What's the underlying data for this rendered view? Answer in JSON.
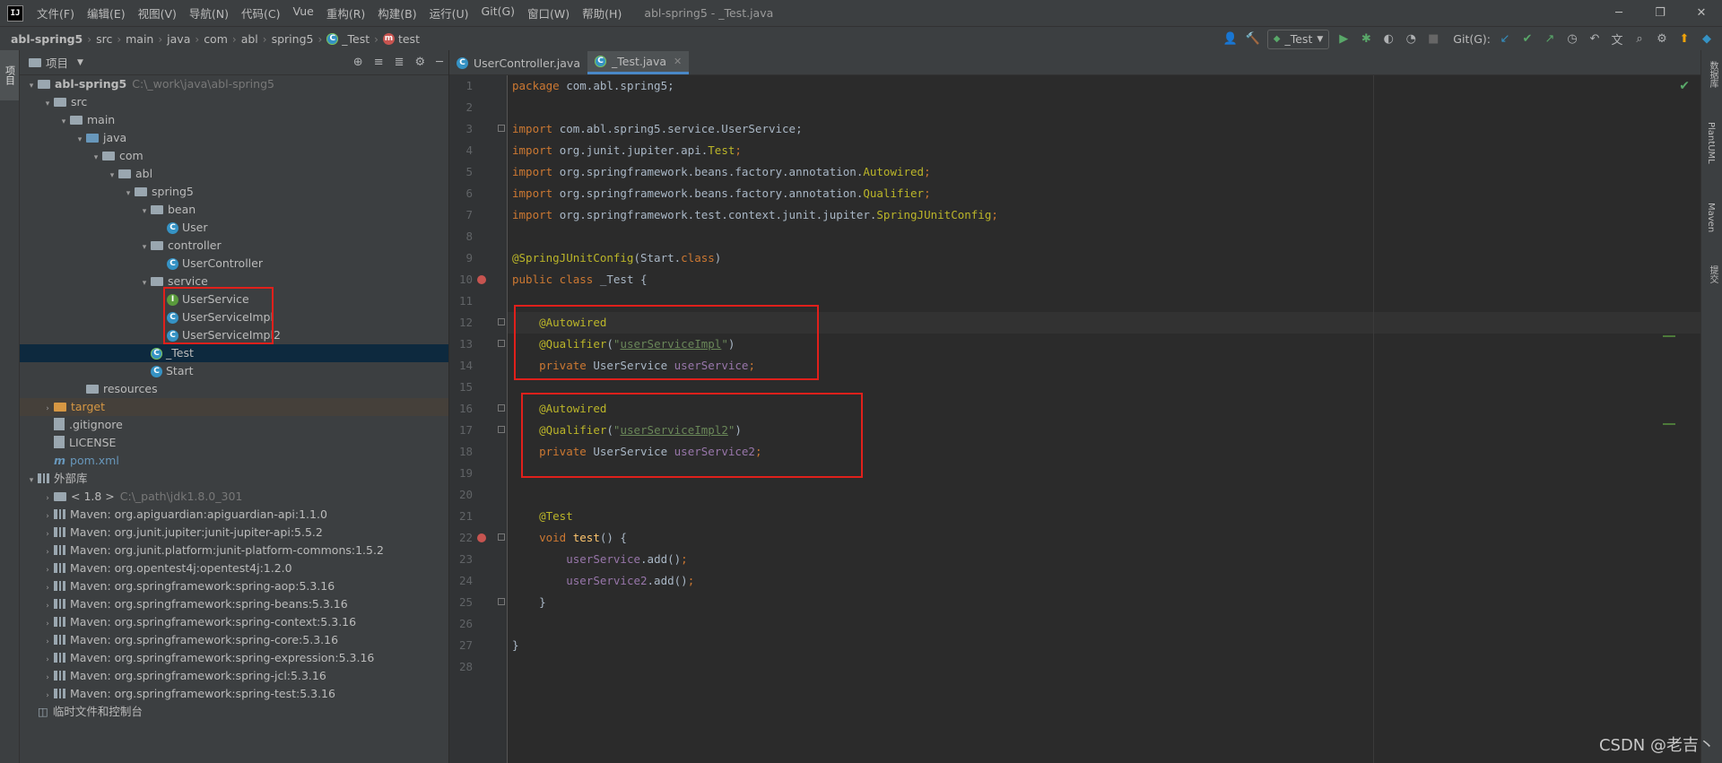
{
  "menubar": {
    "logo": "IJ",
    "items": [
      "文件(F)",
      "编辑(E)",
      "视图(V)",
      "导航(N)",
      "代码(C)",
      "Vue",
      "重构(R)",
      "构建(B)",
      "运行(U)",
      "Git(G)",
      "窗口(W)",
      "帮助(H)"
    ],
    "title": "abl-spring5 - _Test.java",
    "controls": [
      "─",
      "❐",
      "✕"
    ]
  },
  "breadcrumb": {
    "items": [
      "abl-spring5",
      "src",
      "main",
      "java",
      "com",
      "abl",
      "spring5",
      "_Test",
      "test"
    ]
  },
  "toolbar": {
    "run_config": "_Test",
    "git_label": "Git(G):"
  },
  "project_panel": {
    "title": "项目",
    "tree": [
      {
        "label": "abl-spring5",
        "path": "C:\\_work\\java\\abl-spring5",
        "depth": 0,
        "arrow": "▾",
        "icon": "folder",
        "bold": true
      },
      {
        "label": "src",
        "depth": 1,
        "arrow": "▾",
        "icon": "folder"
      },
      {
        "label": "main",
        "depth": 2,
        "arrow": "▾",
        "icon": "folder"
      },
      {
        "label": "java",
        "depth": 3,
        "arrow": "▾",
        "icon": "folder-blue"
      },
      {
        "label": "com",
        "depth": 4,
        "arrow": "▾",
        "icon": "folder"
      },
      {
        "label": "abl",
        "depth": 5,
        "arrow": "▾",
        "icon": "folder"
      },
      {
        "label": "spring5",
        "depth": 6,
        "arrow": "▾",
        "icon": "folder"
      },
      {
        "label": "bean",
        "depth": 7,
        "arrow": "▾",
        "icon": "folder"
      },
      {
        "label": "User",
        "depth": 8,
        "arrow": "",
        "icon": "class"
      },
      {
        "label": "controller",
        "depth": 7,
        "arrow": "▾",
        "icon": "folder"
      },
      {
        "label": "UserController",
        "depth": 8,
        "arrow": "",
        "icon": "class"
      },
      {
        "label": "service",
        "depth": 7,
        "arrow": "▾",
        "icon": "folder"
      },
      {
        "label": "UserService",
        "depth": 8,
        "arrow": "",
        "icon": "interface"
      },
      {
        "label": "UserServiceImpl",
        "depth": 8,
        "arrow": "",
        "icon": "class"
      },
      {
        "label": "UserServiceImpl2",
        "depth": 8,
        "arrow": "",
        "icon": "class"
      },
      {
        "label": "_Test",
        "depth": 7,
        "arrow": "",
        "icon": "test",
        "selected": true
      },
      {
        "label": "Start",
        "depth": 7,
        "arrow": "",
        "icon": "class"
      },
      {
        "label": "resources",
        "depth": 3,
        "arrow": "",
        "icon": "folder"
      },
      {
        "label": "target",
        "depth": 1,
        "arrow": "›",
        "icon": "folder-orange",
        "excluded": true
      },
      {
        "label": ".gitignore",
        "depth": 1,
        "arrow": "",
        "icon": "file"
      },
      {
        "label": "LICENSE",
        "depth": 1,
        "arrow": "",
        "icon": "file"
      },
      {
        "label": "pom.xml",
        "depth": 1,
        "arrow": "",
        "icon": "maven",
        "blue": true
      },
      {
        "label": "外部库",
        "depth": 0,
        "arrow": "▾",
        "icon": "lib"
      },
      {
        "label": "< 1.8 >",
        "path": "C:\\_path\\jdk1.8.0_301",
        "depth": 1,
        "arrow": "›",
        "icon": "folder"
      },
      {
        "label": "Maven: org.apiguardian:apiguardian-api:1.1.0",
        "depth": 1,
        "arrow": "›",
        "icon": "lib"
      },
      {
        "label": "Maven: org.junit.jupiter:junit-jupiter-api:5.5.2",
        "depth": 1,
        "arrow": "›",
        "icon": "lib"
      },
      {
        "label": "Maven: org.junit.platform:junit-platform-commons:1.5.2",
        "depth": 1,
        "arrow": "›",
        "icon": "lib"
      },
      {
        "label": "Maven: org.opentest4j:opentest4j:1.2.0",
        "depth": 1,
        "arrow": "›",
        "icon": "lib"
      },
      {
        "label": "Maven: org.springframework:spring-aop:5.3.16",
        "depth": 1,
        "arrow": "›",
        "icon": "lib"
      },
      {
        "label": "Maven: org.springframework:spring-beans:5.3.16",
        "depth": 1,
        "arrow": "›",
        "icon": "lib"
      },
      {
        "label": "Maven: org.springframework:spring-context:5.3.16",
        "depth": 1,
        "arrow": "›",
        "icon": "lib"
      },
      {
        "label": "Maven: org.springframework:spring-core:5.3.16",
        "depth": 1,
        "arrow": "›",
        "icon": "lib"
      },
      {
        "label": "Maven: org.springframework:spring-expression:5.3.16",
        "depth": 1,
        "arrow": "›",
        "icon": "lib"
      },
      {
        "label": "Maven: org.springframework:spring-jcl:5.3.16",
        "depth": 1,
        "arrow": "›",
        "icon": "lib"
      },
      {
        "label": "Maven: org.springframework:spring-test:5.3.16",
        "depth": 1,
        "arrow": "›",
        "icon": "lib"
      },
      {
        "label": "临时文件和控制台",
        "depth": 0,
        "arrow": "",
        "icon": "scratch"
      }
    ]
  },
  "tabs": [
    {
      "label": "UserController.java",
      "active": false
    },
    {
      "label": "_Test.java",
      "active": true
    }
  ],
  "editor": {
    "lines": [
      [
        [
          "kw",
          "package "
        ],
        [
          "",
          "com.abl.spring5;"
        ]
      ],
      [],
      [
        [
          "kw",
          "import "
        ],
        [
          "",
          "com.abl.spring5.service.UserService;"
        ]
      ],
      [
        [
          "kw",
          "import "
        ],
        [
          "",
          "org.junit.jupiter.api."
        ],
        [
          "ann",
          "Test"
        ],
        [
          "kw",
          ";"
        ]
      ],
      [
        [
          "kw",
          "import "
        ],
        [
          "",
          "org.springframework.beans.factory.annotation."
        ],
        [
          "ann",
          "Autowired"
        ],
        [
          "kw",
          ";"
        ]
      ],
      [
        [
          "kw",
          "import "
        ],
        [
          "",
          "org.springframework.beans.factory.annotation."
        ],
        [
          "ann",
          "Qualifier"
        ],
        [
          "kw",
          ";"
        ]
      ],
      [
        [
          "kw",
          "import "
        ],
        [
          "",
          "org.springframework.test.context.junit.jupiter."
        ],
        [
          "ann",
          "SpringJUnitConfig"
        ],
        [
          "kw",
          ";"
        ]
      ],
      [],
      [
        [
          "ann",
          "@SpringJUnitConfig"
        ],
        [
          "",
          "(Start."
        ],
        [
          "kw",
          "class"
        ],
        [
          "",
          ")"
        ]
      ],
      [
        [
          "kw",
          "public class "
        ],
        [
          "",
          "_Test {"
        ]
      ],
      [],
      [
        [
          "",
          "    "
        ],
        [
          "ann",
          "@Autowired"
        ]
      ],
      [
        [
          "",
          "    "
        ],
        [
          "ann",
          "@Qualifier"
        ],
        [
          "",
          "("
        ],
        [
          "str",
          "\""
        ],
        [
          "strref",
          "userServiceImpl"
        ],
        [
          "str",
          "\""
        ],
        [
          "",
          ")"
        ]
      ],
      [
        [
          "",
          "    "
        ],
        [
          "kw",
          "private "
        ],
        [
          "",
          "UserService "
        ],
        [
          "field",
          "userService"
        ],
        [
          "kw",
          ";"
        ]
      ],
      [],
      [
        [
          "",
          "    "
        ],
        [
          "ann",
          "@Autowired"
        ]
      ],
      [
        [
          "",
          "    "
        ],
        [
          "ann",
          "@Qualifier"
        ],
        [
          "",
          "("
        ],
        [
          "str",
          "\""
        ],
        [
          "strref",
          "userServiceImpl2"
        ],
        [
          "str",
          "\""
        ],
        [
          "",
          ")"
        ]
      ],
      [
        [
          "",
          "    "
        ],
        [
          "kw",
          "private "
        ],
        [
          "",
          "UserService "
        ],
        [
          "field",
          "userService2"
        ],
        [
          "kw",
          ";"
        ]
      ],
      [],
      [],
      [
        [
          "",
          "    "
        ],
        [
          "ann",
          "@Test"
        ]
      ],
      [
        [
          "",
          "    "
        ],
        [
          "kw",
          "void "
        ],
        [
          "fn",
          "test"
        ],
        [
          "",
          "() {"
        ]
      ],
      [
        [
          "",
          "        "
        ],
        [
          "field",
          "userService"
        ],
        [
          "",
          ".add()"
        ],
        [
          "kw",
          ";"
        ]
      ],
      [
        [
          "",
          "        "
        ],
        [
          "field",
          "userService2"
        ],
        [
          "",
          ".add()"
        ],
        [
          "kw",
          ";"
        ]
      ],
      [
        [
          "",
          "    }"
        ]
      ],
      [],
      [
        [
          "",
          "}"
        ]
      ],
      []
    ],
    "current_line": 12
  },
  "right_stripe": [
    "数据库",
    "PlantUML",
    "Maven",
    "提交"
  ],
  "watermark": "CSDN @老吉丶",
  "colors": {
    "highlight_box": "#e0201b",
    "selection": "#0d293e",
    "accent": "#4a88c7"
  }
}
